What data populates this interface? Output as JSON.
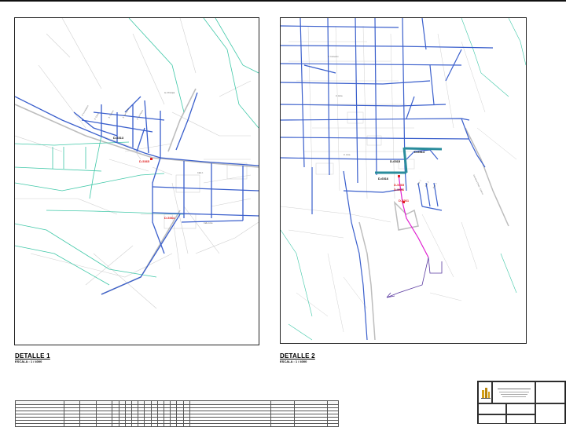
{
  "details": [
    {
      "title": "DETALLE 1",
      "scale": "ESCALA : 1 / 4000",
      "labels": [
        {
          "text": "D-6513",
          "color": "#111111"
        },
        {
          "text": "D-5365",
          "color": "#e02020"
        },
        {
          "text": "D-5364",
          "color": "#e02020"
        }
      ]
    },
    {
      "title": "DETALLE 2",
      "scale": "ESCALA : 1 / 4000",
      "labels": [
        {
          "text": "D-6514",
          "color": "#111111"
        },
        {
          "text": "D-6515",
          "color": "#111111"
        },
        {
          "text": "D-6516",
          "color": "#111111"
        },
        {
          "text": "D-5365",
          "color": "#e02020"
        },
        {
          "text": "D-5366",
          "color": "#e02020"
        },
        {
          "text": "D-5361",
          "color": "#e02020"
        }
      ]
    }
  ],
  "colors": {
    "road_outline": "#c8c8c8",
    "pipe_network": "#3a5fcc",
    "canal": "#40c8a8",
    "new_pipe": "#2a8c9c",
    "conduction": "#e020d0",
    "label_red": "#e02020"
  },
  "title_block": {
    "logo_icon": "building-logo-icon"
  }
}
